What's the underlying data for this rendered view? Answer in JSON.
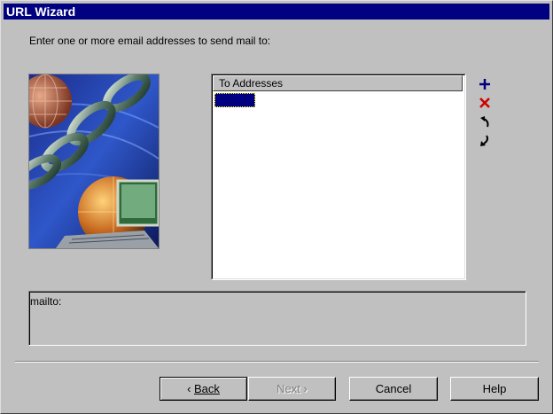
{
  "window": {
    "title": "URL Wizard"
  },
  "instructions": "Enter one or more email addresses to send mail to:",
  "list": {
    "column_header": "To Addresses",
    "rows": [
      ""
    ],
    "selected_index": 0
  },
  "toolbar": {
    "add_icon": "plus-icon",
    "delete_icon": "delete-x-icon",
    "move_up_icon": "move-up-arrow-icon",
    "move_down_icon": "move-down-arrow-icon",
    "add_color": "#000080",
    "delete_color": "#cc0000"
  },
  "preview": {
    "text": "mailto:"
  },
  "buttons": {
    "back_prefix": "‹ ",
    "back_label": "Back",
    "next_label": "Next ›",
    "cancel_label": "Cancel",
    "help_label": "Help"
  },
  "colors": {
    "titlebar": "#000080",
    "face": "#c0c0c0",
    "selection": "#000080"
  }
}
